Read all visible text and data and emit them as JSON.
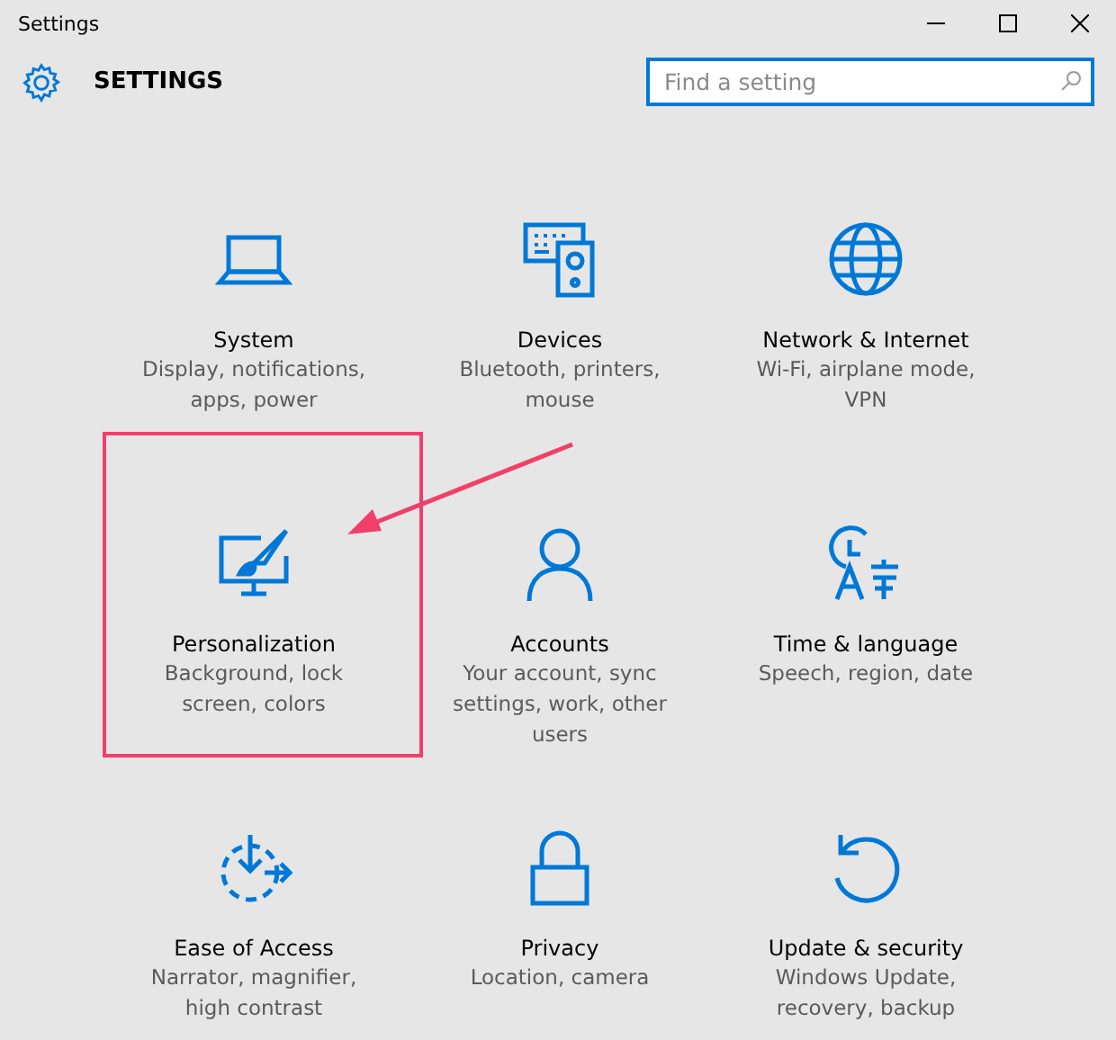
{
  "window": {
    "title": "Settings"
  },
  "header": {
    "title": "SETTINGS",
    "search": {
      "placeholder": "Find a setting"
    }
  },
  "categories": [
    {
      "title": "System",
      "description": "Display, notifications,\napps, power",
      "highlighted": false
    },
    {
      "title": "Devices",
      "description": "Bluetooth, printers,\nmouse",
      "highlighted": false
    },
    {
      "title": "Network & Internet",
      "description": "Wi-Fi, airplane mode,\nVPN",
      "highlighted": false
    },
    {
      "title": "Personalization",
      "description": "Background, lock\nscreen, colors",
      "highlighted": true
    },
    {
      "title": "Accounts",
      "description": "Your account, sync\nsettings, work, other\nusers",
      "highlighted": false
    },
    {
      "title": "Time & language",
      "description": "Speech, region, date",
      "highlighted": false
    },
    {
      "title": "Ease of Access",
      "description": "Narrator, magnifier,\nhigh contrast",
      "highlighted": false
    },
    {
      "title": "Privacy",
      "description": "Location, camera",
      "highlighted": false
    },
    {
      "title": "Update & security",
      "description": "Windows Update,\nrecovery, backup",
      "highlighted": false
    }
  ]
}
